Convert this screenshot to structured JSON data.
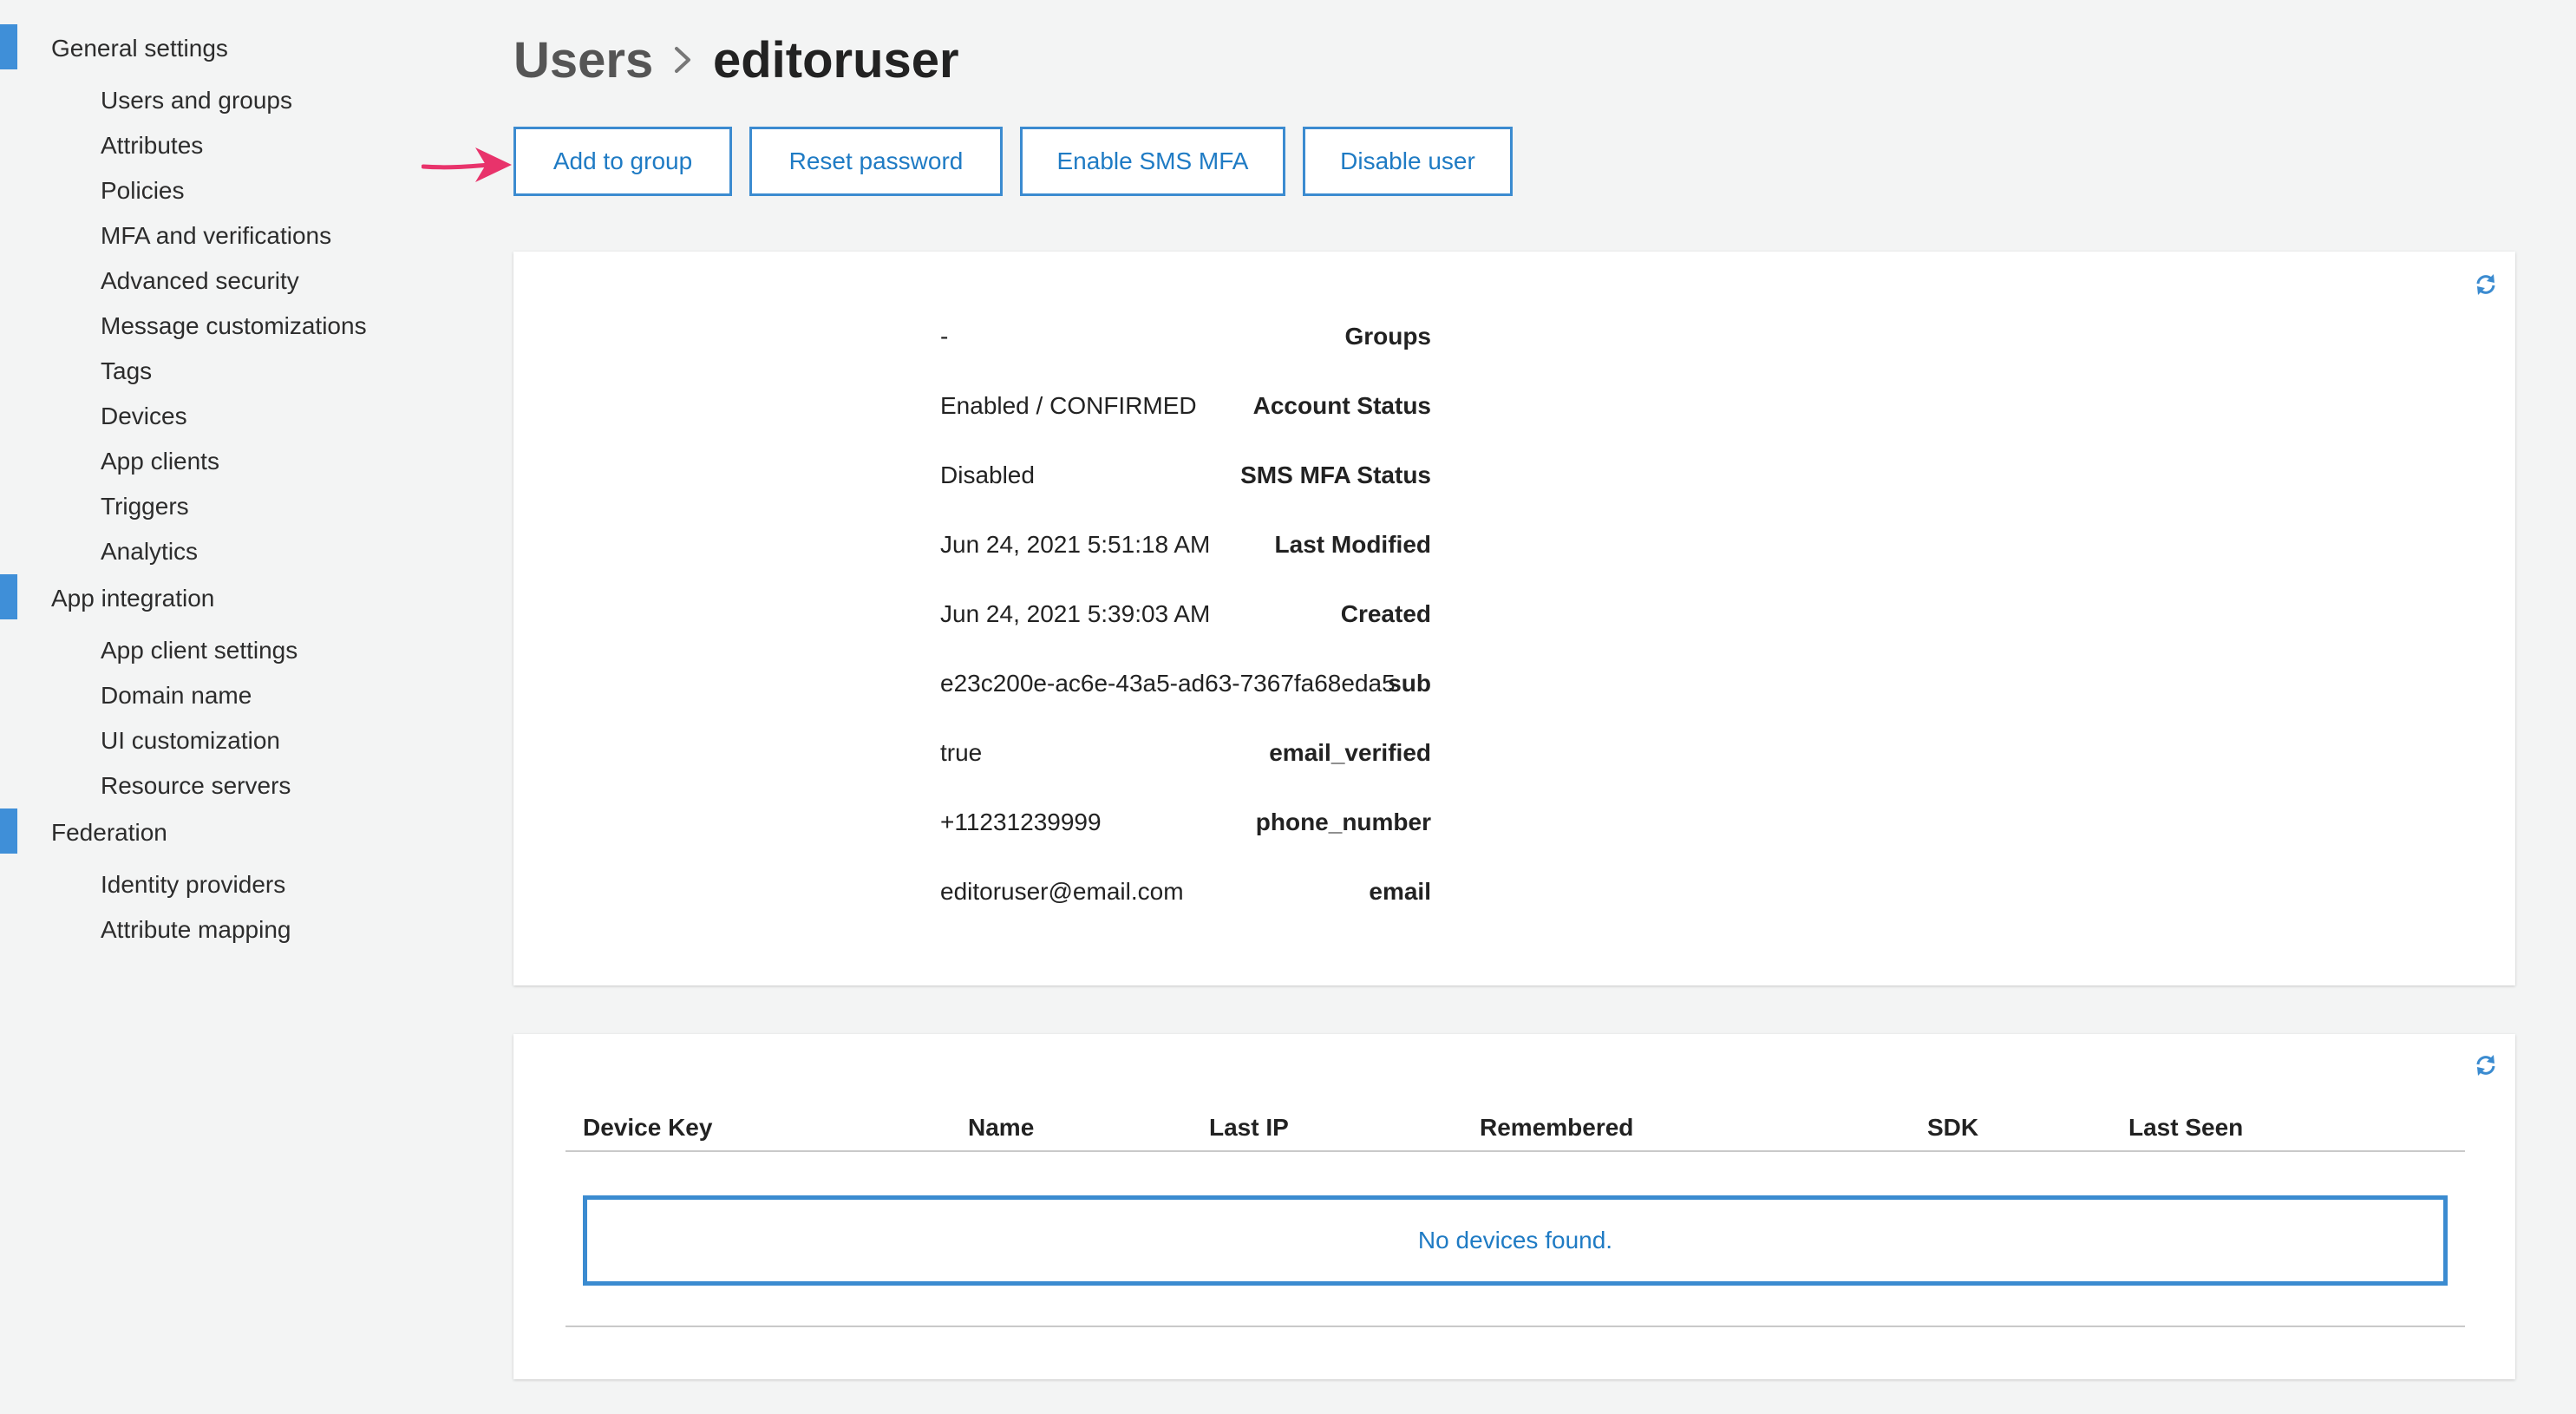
{
  "sidebar": {
    "sections": [
      {
        "label": "General settings",
        "items": [
          "Users and groups",
          "Attributes",
          "Policies",
          "MFA and verifications",
          "Advanced security",
          "Message customizations",
          "Tags",
          "Devices",
          "App clients",
          "Triggers",
          "Analytics"
        ]
      },
      {
        "label": "App integration",
        "items": [
          "App client settings",
          "Domain name",
          "UI customization",
          "Resource servers"
        ]
      },
      {
        "label": "Federation",
        "items": [
          "Identity providers",
          "Attribute mapping"
        ]
      }
    ]
  },
  "breadcrumb": {
    "parent": "Users",
    "current": "editoruser"
  },
  "actions": {
    "add_to_group": "Add to group",
    "reset_password": "Reset password",
    "enable_sms_mfa": "Enable SMS MFA",
    "disable_user": "Disable user"
  },
  "details": [
    {
      "label": "Groups",
      "value": "-"
    },
    {
      "label": "Account Status",
      "value": "Enabled / CONFIRMED"
    },
    {
      "label": "SMS MFA Status",
      "value": "Disabled"
    },
    {
      "label": "Last Modified",
      "value": "Jun 24, 2021 5:51:18 AM"
    },
    {
      "label": "Created",
      "value": "Jun 24, 2021 5:39:03 AM"
    },
    {
      "label": "sub",
      "value": "e23c200e-ac6e-43a5-ad63-7367fa68eda5"
    },
    {
      "label": "email_verified",
      "value": "true"
    },
    {
      "label": "phone_number",
      "value": "+11231239999"
    },
    {
      "label": "email",
      "value": "editoruser@email.com"
    }
  ],
  "devices": {
    "columns": [
      "Device Key",
      "Name",
      "Last IP",
      "Remembered",
      "SDK",
      "Last Seen"
    ],
    "empty_message": "No devices found."
  },
  "colors": {
    "accent": "#3b8bd0",
    "link": "#1f7bc4",
    "annotation_arrow": "#e8336b"
  }
}
